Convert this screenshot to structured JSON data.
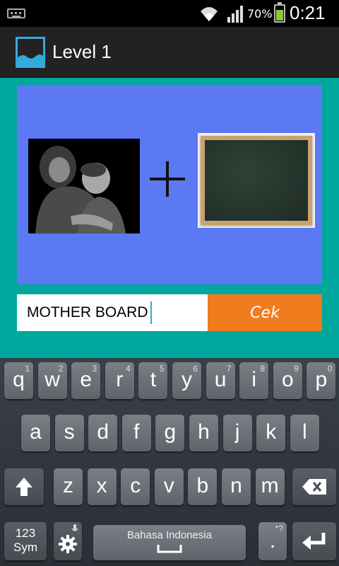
{
  "status_bar": {
    "battery_percent": "70%",
    "time": "0:21",
    "icons": [
      "keyboard-icon",
      "wifi-icon",
      "signal-icon",
      "battery-icon"
    ],
    "battery_level": 0.7
  },
  "action_bar": {
    "title": "Level 1",
    "app_icon": "picture-icon"
  },
  "puzzle": {
    "left_image": "mother-photo",
    "operator": "+",
    "right_image": "blackboard-photo"
  },
  "answer": {
    "value": "MOTHER BOARD",
    "button_label": "Cek"
  },
  "keyboard": {
    "row1": [
      {
        "ch": "q",
        "hint": "1"
      },
      {
        "ch": "w",
        "hint": "2"
      },
      {
        "ch": "e",
        "hint": "3"
      },
      {
        "ch": "r",
        "hint": "4"
      },
      {
        "ch": "t",
        "hint": "5"
      },
      {
        "ch": "y",
        "hint": "6"
      },
      {
        "ch": "u",
        "hint": "7"
      },
      {
        "ch": "i",
        "hint": "8"
      },
      {
        "ch": "o",
        "hint": "9"
      },
      {
        "ch": "p",
        "hint": "0"
      }
    ],
    "row2": [
      "a",
      "s",
      "d",
      "f",
      "g",
      "h",
      "j",
      "k",
      "l"
    ],
    "row3": [
      "z",
      "x",
      "c",
      "v",
      "b",
      "n",
      "m"
    ],
    "sym_label": "123\nSym",
    "space_label": "Bahasa Indonesia",
    "period": ".",
    "period_hint": "*?",
    "shift_icon": "shift-icon",
    "backspace_icon": "backspace-icon",
    "settings_icon": "gear-icon",
    "enter_icon": "enter-icon",
    "colors": {
      "accent": "#33aadd",
      "button": "#f07c1e",
      "panel": "#5b79f2",
      "background": "#00a79d"
    }
  }
}
